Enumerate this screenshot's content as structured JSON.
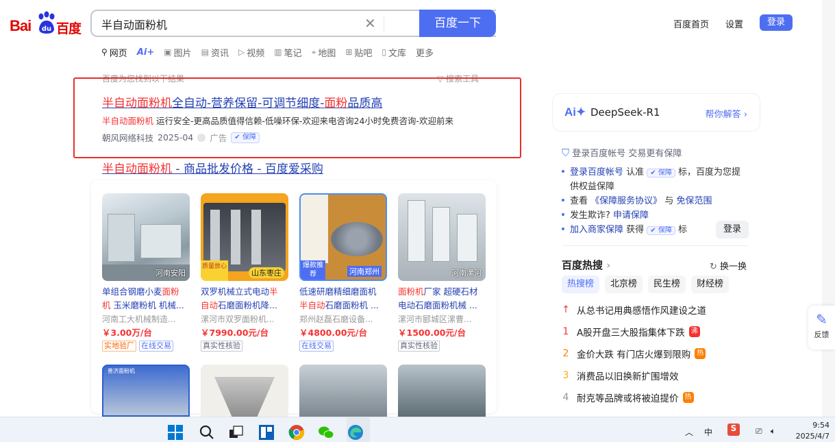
{
  "search": {
    "query": "半自动面粉机",
    "button": "百度一下"
  },
  "header_links": {
    "home": "百度首页",
    "settings": "设置",
    "login": "登录"
  },
  "tabs": [
    {
      "label": "网页",
      "icon": "search-icon"
    },
    {
      "label": "Ai+",
      "icon": "ai-icon"
    },
    {
      "label": "图片",
      "icon": "image-icon"
    },
    {
      "label": "资讯",
      "icon": "news-icon"
    },
    {
      "label": "视频",
      "icon": "video-icon"
    },
    {
      "label": "笔记",
      "icon": "note-icon"
    },
    {
      "label": "地图",
      "icon": "map-icon"
    },
    {
      "label": "贴吧",
      "icon": "tieba-icon"
    },
    {
      "label": "文库",
      "icon": "doc-icon"
    },
    {
      "label": "更多",
      "icon": ""
    }
  ],
  "result_tip": "百度为您找到以下结果",
  "search_tools": "搜索工具",
  "ad": {
    "title_red": "半自动面粉机",
    "title_rest1": "全自动-营养保留-可调节细度-",
    "title_red2": "面粉",
    "title_rest2": "品质高",
    "desc_red": "半自动面粉机",
    "desc_rest": " 运行安全-更高品质值得信赖-低噪环保-欢迎来电咨询24小时免费咨询-欢迎前来",
    "company": "朝风网络科技",
    "date": "2025-04",
    "ad_label": "广告",
    "badge": "保障"
  },
  "result2": {
    "title_red": "半自动面粉机",
    "title_rest": " - 商品批发价格 - 百度爱采购"
  },
  "products": [
    {
      "loc": "河南安阳",
      "t1a": "单组合钢磨小麦",
      "t1b": "面粉",
      "t2a": "机",
      "t2b": " 玉米磨粉机 机械...",
      "comp": "河南工大机械制造...",
      "price": "￥3.00万/台",
      "tags": [
        {
          "text": "实地验厂",
          "c": "orange"
        },
        {
          "text": "在线交易",
          "c": "blue"
        }
      ]
    },
    {
      "loc": "山东枣庄",
      "badge": "质量放心",
      "t1a": "双罗机械立式电动",
      "t1b": "半",
      "t2a": "自动",
      "t2b": "石磨面粉机降...",
      "comp": "漯河市双罗面粉机...",
      "price": "￥7990.00元/台",
      "tags": [
        {
          "text": "真实性核验",
          "c": "gray"
        }
      ]
    },
    {
      "loc": "河南郑州",
      "badge": "爆款推荐",
      "t1a": "低速研磨精细磨面机",
      "t1b": "",
      "t2a": "半自动",
      "t2b": "石磨面粉机 ...",
      "comp": "郑州赵磊石磨设备...",
      "price": "￥4800.00元/台",
      "tags": [
        {
          "text": "在线交易",
          "c": "blue"
        }
      ]
    },
    {
      "loc": "河南漯河",
      "t1a": "面粉机",
      "t1b": "厂家 超硬石材",
      "t2a": "电动石磨",
      "t2b": "面粉机械 ...",
      "comp": "漯河市郾城区漯曹...",
      "price": "￥1500.00元/台",
      "tags": [
        {
          "text": "真实性核验",
          "c": "gray"
        }
      ]
    }
  ],
  "product_row2_label": "普济面粉机",
  "right": {
    "ds_name": "DeepSeek-R1",
    "ds_help": "帮你解答",
    "guard_head": "登录百度帐号 交易更有保障",
    "l1a": "登录百度帐号",
    "l1b": " 认准",
    "l1c": "标，百度为您提",
    "l1d": "供权益保障",
    "l2a": "查看",
    "l2b": "《保障服务协议》",
    "l2c": "与",
    "l2d": "免保范围",
    "l3a": "发生欺诈?",
    "l3b": "申请保障",
    "l4a": "加入商家保障",
    "l4b": " 获得",
    "l4c": "标",
    "badge": "保障",
    "login": "登录"
  },
  "hot": {
    "title": "百度热搜",
    "change": "换一换",
    "tabs": [
      "热搜榜",
      "北京榜",
      "民生榜",
      "财经榜"
    ],
    "items": [
      {
        "idx": "↑",
        "text": "从总书记用典感悟作风建设之道",
        "badge": ""
      },
      {
        "idx": "1",
        "text": "A股开盘三大股指集体下跌",
        "badge": "沸"
      },
      {
        "idx": "2",
        "text": "金价大跌 有门店火爆到限购",
        "badge": "热"
      },
      {
        "idx": "3",
        "text": "消费品以旧换新扩围增效",
        "badge": ""
      },
      {
        "idx": "4",
        "text": "耐克等品牌或将被迫提价",
        "badge": "热"
      }
    ]
  },
  "feedback": "反馈",
  "clock": {
    "time": "9:54",
    "date": "2025/4/7"
  },
  "colors": {
    "brand": "#4e6ef2",
    "red": "#f73131",
    "link": "#2440b3"
  }
}
